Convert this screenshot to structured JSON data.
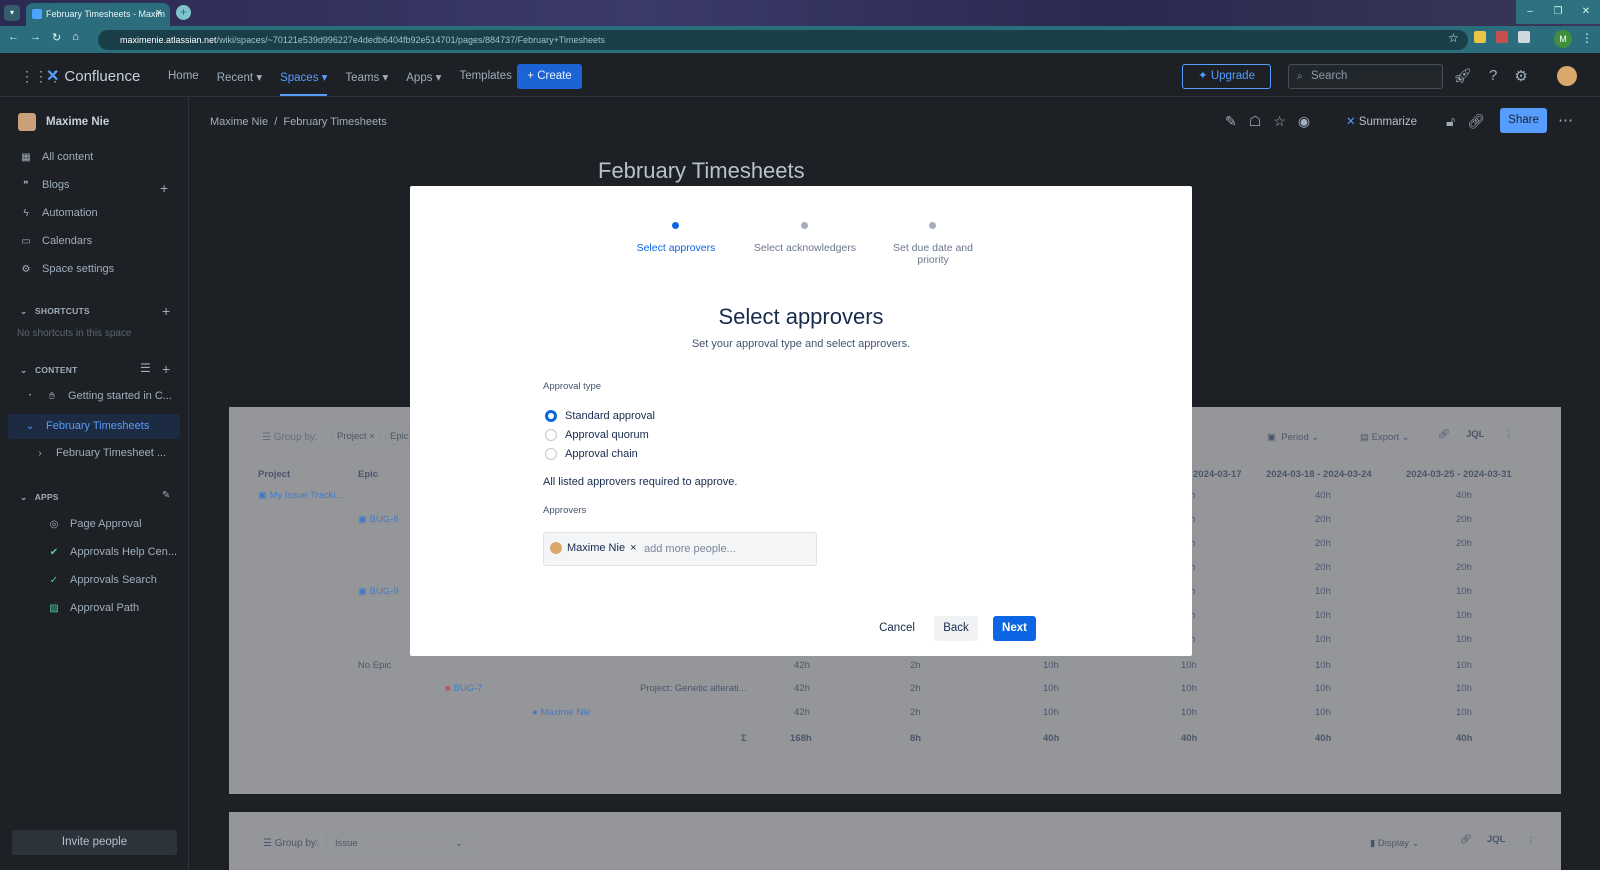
{
  "browser": {
    "tab_title": "February Timesheets - Maxim",
    "url_host": "maximenie.atlassian.net",
    "url_path": "/wiki/spaces/~70121e539d996227e4dedb6404fb92e514701/pages/884737/February+Timesheets",
    "profile_initial": "M"
  },
  "topnav": {
    "product": "Confluence",
    "links": [
      "Home",
      "Recent",
      "Spaces",
      "Teams",
      "Apps",
      "Templates"
    ],
    "create": "Create",
    "upgrade": "Upgrade",
    "search_placeholder": "Search"
  },
  "sidebar": {
    "space_name": "Maxime Nie",
    "items": [
      "All content",
      "Blogs",
      "Automation",
      "Calendars",
      "Space settings"
    ],
    "shortcuts_header": "SHORTCUTS",
    "shortcuts_empty": "No shortcuts in this space",
    "content_header": "CONTENT",
    "content_items": [
      "Getting started in C...",
      "February Timesheets",
      "February Timesheet ..."
    ],
    "apps_header": "APPS",
    "apps_items": [
      "Page Approval",
      "Approvals Help Cen...",
      "Approvals Search",
      "Approval Path"
    ],
    "invite": "Invite people"
  },
  "page": {
    "breadcrumb_space": "Maxime Nie",
    "breadcrumb_sep": "/",
    "breadcrumb_page": "February Timesheets",
    "summarize": "Summarize",
    "share": "Share",
    "title": "February Timesheets"
  },
  "table1": {
    "group_by": "Group by:",
    "chips": [
      "Project",
      "Epic"
    ],
    "period": "Period",
    "export": "Export",
    "jql": "JQL",
    "headers": [
      "Project",
      "Epic",
      "2024-03-17",
      "2024-03-18 - 2024-03-24",
      "2024-03-25 - 2024-03-31"
    ],
    "project_link": "My Issue Tracki...",
    "epics": [
      "BUG-8",
      "BUG-9",
      "No Epic"
    ],
    "bug7": "BUG-7",
    "bug7_summary": "Project: Genetic alterati...",
    "assignee": "Maxime Nie",
    "col_a": [
      "h",
      "h",
      "h",
      "h",
      "h",
      "h",
      "h"
    ],
    "col_b": [
      "40h",
      "20h",
      "20h",
      "20h",
      "10h",
      "10h",
      "10h"
    ],
    "col_c": [
      "40h",
      "20h",
      "20h",
      "20h",
      "10h",
      "10h",
      "10h"
    ],
    "bottom_rows": [
      [
        "42h",
        "2h",
        "10h",
        "10h",
        "10h",
        "10h"
      ],
      [
        "42h",
        "2h",
        "10h",
        "10h",
        "10h",
        "10h"
      ],
      [
        "42h",
        "2h",
        "10h",
        "10h",
        "10h",
        "10h"
      ]
    ],
    "sigma": "Σ",
    "totals": [
      "168h",
      "8h",
      "40h",
      "40h",
      "40h",
      "40h"
    ]
  },
  "table2": {
    "group_by": "Group by:",
    "select_value": "Issue",
    "display": "Display",
    "jql": "JQL"
  },
  "modal": {
    "steps": [
      "Select approvers",
      "Select acknowledgers",
      "Set due date and priority"
    ],
    "title": "Select approvers",
    "subtitle": "Set your approval type and select approvers.",
    "approval_type_label": "Approval type",
    "options": [
      "Standard approval",
      "Approval quorum",
      "Approval chain"
    ],
    "selected_option": "Standard approval",
    "hint": "All listed approvers required to approve.",
    "approvers_label": "Approvers",
    "approver_chip": "Maxime Nie",
    "picker_placeholder": "add more people...",
    "cancel": "Cancel",
    "back": "Back",
    "next": "Next"
  },
  "colors": {
    "accent": "#0c66e4",
    "dark_bg": "#1d2125",
    "chrome": "#2b6d7c"
  }
}
